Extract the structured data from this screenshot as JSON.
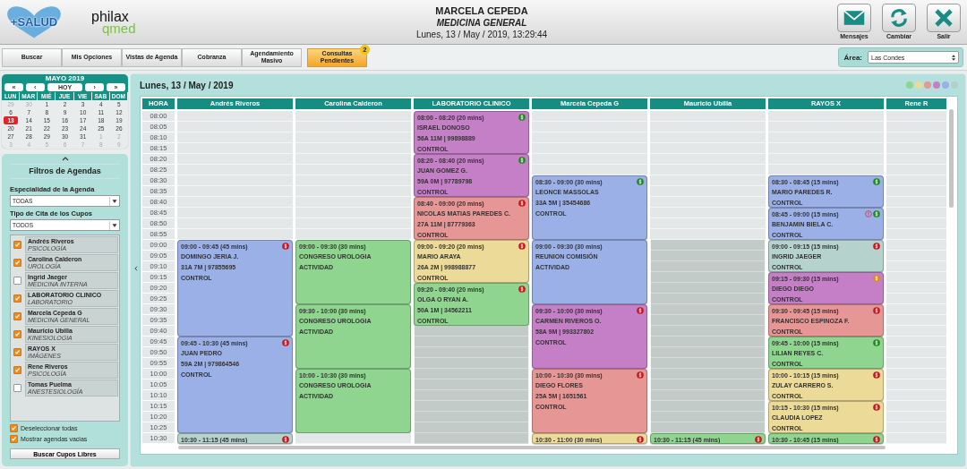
{
  "header": {
    "logo_left": "+SALUD",
    "logo_right_top": "philax",
    "logo_right_bottom": "qmed",
    "user": "MARCELA CEPEDA",
    "specialty": "MEDICINA GENERAL",
    "datetime": "Lunes, 13 / May / 2019, 13:29:44",
    "actions": [
      {
        "label": "Mensajes",
        "kind": "mail"
      },
      {
        "label": "Cambiar",
        "kind": "refresh"
      },
      {
        "label": "Salir",
        "kind": "exit"
      }
    ]
  },
  "nav": {
    "tabs": [
      {
        "label": "Buscar",
        "kind": "plain"
      },
      {
        "label": "Mis Opciones",
        "kind": "plain"
      },
      {
        "label": "Vistas de Agenda",
        "kind": "plain"
      },
      {
        "label": "Cobranza",
        "kind": "plain"
      },
      {
        "label": "Agendamiento Masivo",
        "kind": "plain"
      },
      {
        "label": "Consultas Pendientes",
        "kind": "highlight",
        "badge": "2"
      }
    ],
    "area": {
      "label": "Área:",
      "value": "Las Condes"
    }
  },
  "calendar": {
    "title": "MAYO 2019",
    "nav": [
      "«",
      "‹",
      "HOY",
      "›",
      "»"
    ],
    "weekdays": [
      "LUN",
      "MAR",
      "MIÉ",
      "JUE",
      "VIE",
      "SAB",
      "DOM"
    ],
    "weeks": [
      [
        {
          "day": "29",
          "other_month": true,
          "selected": false
        },
        {
          "day": "30",
          "other_month": true,
          "selected": false
        },
        {
          "day": "1",
          "other_month": false,
          "selected": false
        },
        {
          "day": "2",
          "other_month": false,
          "selected": false
        },
        {
          "day": "3",
          "other_month": false,
          "selected": false
        },
        {
          "day": "4",
          "other_month": false,
          "selected": false
        },
        {
          "day": "5",
          "other_month": false,
          "selected": false
        }
      ],
      [
        {
          "day": "6",
          "other_month": false,
          "selected": false
        },
        {
          "day": "7",
          "other_month": false,
          "selected": false
        },
        {
          "day": "8",
          "other_month": false,
          "selected": false
        },
        {
          "day": "9",
          "other_month": false,
          "selected": false
        },
        {
          "day": "10",
          "other_month": false,
          "selected": false
        },
        {
          "day": "11",
          "other_month": false,
          "selected": false
        },
        {
          "day": "12",
          "other_month": false,
          "selected": false
        }
      ],
      [
        {
          "day": "13",
          "other_month": false,
          "selected": true
        },
        {
          "day": "14",
          "other_month": false,
          "selected": false
        },
        {
          "day": "15",
          "other_month": false,
          "selected": false
        },
        {
          "day": "16",
          "other_month": false,
          "selected": false
        },
        {
          "day": "17",
          "other_month": false,
          "selected": false
        },
        {
          "day": "18",
          "other_month": false,
          "selected": false
        },
        {
          "day": "19",
          "other_month": false,
          "selected": false
        }
      ],
      [
        {
          "day": "20",
          "other_month": false,
          "selected": false
        },
        {
          "day": "21",
          "other_month": false,
          "selected": false
        },
        {
          "day": "22",
          "other_month": false,
          "selected": false
        },
        {
          "day": "23",
          "other_month": false,
          "selected": false
        },
        {
          "day": "24",
          "other_month": false,
          "selected": false
        },
        {
          "day": "25",
          "other_month": false,
          "selected": false
        },
        {
          "day": "26",
          "other_month": false,
          "selected": false
        }
      ],
      [
        {
          "day": "27",
          "other_month": false,
          "selected": false
        },
        {
          "day": "28",
          "other_month": false,
          "selected": false
        },
        {
          "day": "29",
          "other_month": false,
          "selected": false
        },
        {
          "day": "30",
          "other_month": false,
          "selected": false
        },
        {
          "day": "31",
          "other_month": false,
          "selected": false
        },
        {
          "day": "1",
          "other_month": true,
          "selected": false
        },
        {
          "day": "2",
          "other_month": true,
          "selected": false
        }
      ],
      [
        {
          "day": "3",
          "other_month": true,
          "selected": false
        },
        {
          "day": "4",
          "other_month": true,
          "selected": false
        },
        {
          "day": "5",
          "other_month": true,
          "selected": false
        },
        {
          "day": "6",
          "other_month": true,
          "selected": false
        },
        {
          "day": "7",
          "other_month": true,
          "selected": false
        },
        {
          "day": "8",
          "other_month": true,
          "selected": false
        },
        {
          "day": "9",
          "other_month": true,
          "selected": false
        }
      ]
    ]
  },
  "filters": {
    "title": "Filtros de Agendas",
    "fields": [
      {
        "label": "Especialidad de la Agenda",
        "value": "TODAS"
      },
      {
        "label": "Tipo de Cita de los Cupos",
        "value": "TODOS"
      }
    ],
    "agendas": [
      {
        "name": "Andrés Riveros",
        "specialty": "PSICOLOGÍA",
        "checked": true
      },
      {
        "name": "Carolina Calderon",
        "specialty": "UROLOGÍA",
        "checked": true
      },
      {
        "name": "Ingrid Jaeger",
        "specialty": "MEDICINA INTERNA",
        "checked": false
      },
      {
        "name": "LABORATORIO CLINICO",
        "specialty": "LABORATORIO",
        "checked": true
      },
      {
        "name": "Marcela Cepeda G",
        "specialty": "MEDICINA GENERAL",
        "checked": true
      },
      {
        "name": "Mauricio Ubilla",
        "specialty": "KINESIOLOGIA",
        "checked": true
      },
      {
        "name": "RAYOS X",
        "specialty": "IMÁGENES",
        "checked": true
      },
      {
        "name": "Rene Riveros",
        "specialty": "PSICOLOGÍA",
        "checked": true
      },
      {
        "name": "Tomas Puelma",
        "specialty": "ANESTESIOLOGÍA",
        "checked": false
      }
    ],
    "options": [
      {
        "label": "Deseleccionar todas",
        "checked": true
      },
      {
        "label": "Mostrar agendas vacias",
        "checked": true
      }
    ],
    "button": "Buscar Cupos Libres"
  },
  "schedule": {
    "date": "Lunes, 13 / May / 2019",
    "legend": [
      {
        "color": "#8fd48f"
      },
      {
        "color": "#ecdb98"
      },
      {
        "color": "#e69694"
      },
      {
        "color": "#c47fc6"
      },
      {
        "color": "#9bb0e6"
      },
      {
        "color": "#b5cfca"
      }
    ],
    "hour_header": "HORA",
    "hours": [
      "08:00",
      "08:05",
      "08:10",
      "08:15",
      "08:20",
      "08:25",
      "08:30",
      "08:35",
      "08:40",
      "08:45",
      "08:50",
      "08:55",
      "09:00",
      "09:05",
      "09:10",
      "09:15",
      "09:20",
      "09:25",
      "09:30",
      "09:35",
      "09:40",
      "09:45",
      "09:50",
      "09:55",
      "10:00",
      "10:05",
      "10:10",
      "10:15",
      "10:20",
      "10:25",
      "10:30"
    ],
    "columns": [
      {
        "name": "Andrés Riveros",
        "entries": [
          {
            "kind": "free"
          },
          {
            "kind": "free"
          },
          {
            "kind": "free"
          },
          {
            "kind": "free"
          },
          {
            "kind": "free"
          },
          {
            "kind": "free"
          },
          {
            "kind": "free"
          },
          {
            "kind": "free"
          },
          {
            "kind": "free"
          },
          {
            "kind": "free"
          },
          {
            "kind": "free"
          },
          {
            "kind": "free"
          },
          {
            "kind": "appointment",
            "color": "#9bb0e6",
            "time": "09:00 - 09:45 (45 mins)",
            "lines": [
              "DOMINGO JERIA J.",
              "31A 7M | 97855695",
              "CONTROL"
            ],
            "payment_icon": {
              "color": "#c8151b"
            },
            "alert": false
          },
          {
            "kind": "appointment",
            "color": "#9bb0e6",
            "time": "09:45 - 10:30 (45 mins)",
            "lines": [
              "JUAN PEDRO",
              "59A 2M | 979864546",
              "CONTROL"
            ],
            "payment_icon": {
              "color": "#c8151b"
            },
            "alert": false
          },
          {
            "kind": "appointment",
            "color": "#b5d3cc",
            "time": "10:30 - 11:15 (45 mins)",
            "payment_icon": {
              "color": "#c8151b"
            },
            "alert": false
          }
        ]
      },
      {
        "name": "Carolina Calderon",
        "entries": [
          {
            "kind": "free"
          },
          {
            "kind": "free"
          },
          {
            "kind": "free"
          },
          {
            "kind": "free"
          },
          {
            "kind": "free"
          },
          {
            "kind": "free"
          },
          {
            "kind": "free"
          },
          {
            "kind": "free"
          },
          {
            "kind": "free"
          },
          {
            "kind": "free"
          },
          {
            "kind": "free"
          },
          {
            "kind": "free"
          },
          {
            "kind": "appointment",
            "color": "#8fd48f",
            "time": "09:00 - 09:30 (30 mins)",
            "lines": [
              "CONGRESO UROLOGIA",
              "ACTIVIDAD"
            ],
            "alert": false
          },
          {
            "kind": "appointment",
            "color": "#8fd48f",
            "time": "09:30 - 10:00 (30 mins)",
            "lines": [
              "CONGRESO UROLOGIA",
              "ACTIVIDAD"
            ],
            "alert": false
          },
          {
            "kind": "appointment",
            "color": "#8fd48f",
            "time": "10:00 - 10:30 (30 mins)",
            "lines": [
              "CONGRESO UROLOGIA",
              "ACTIVIDAD"
            ],
            "alert": false
          },
          {
            "kind": "free"
          }
        ]
      },
      {
        "name": "LABORATORIO CLINICO",
        "entries": [
          {
            "kind": "appointment",
            "color": "#c47fc6",
            "time": "08:00 - 08:20 (20 mins)",
            "lines": [
              "ISRAEL DONOSO",
              "56A 11M | 99898889",
              "CONTROL"
            ],
            "payment_icon": {
              "color": "#1f8a1f"
            },
            "alert": false
          },
          {
            "kind": "appointment",
            "color": "#c47fc6",
            "time": "08:20 - 08:40 (20 mins)",
            "lines": [
              "JUAN GOMEZ G.",
              "59A 0M | 97789798",
              "CONTROL"
            ],
            "payment_icon": {
              "color": "#1f8a1f"
            },
            "alert": false
          },
          {
            "kind": "appointment",
            "color": "#e69694",
            "time": "08:40 - 09:00 (20 mins)",
            "lines": [
              "NICOLAS MATIAS PAREDES C.",
              "27A 11M | 87779363",
              "CONTROL"
            ],
            "payment_icon": {
              "color": "#c8151b"
            },
            "alert": false
          },
          {
            "kind": "appointment",
            "color": "#ecdb98",
            "time": "09:00 - 09:20 (20 mins)",
            "lines": [
              "MARIO ARAYA",
              "26A 2M | 998988877",
              "CONTROL"
            ],
            "payment_icon": {
              "color": "#c8151b"
            },
            "alert": false
          },
          {
            "kind": "appointment",
            "color": "#8fd48f",
            "time": "09:20 - 09:40 (20 mins)",
            "lines": [
              "OLGA O RYAN A.",
              "50A 1M | 34562211",
              "CONTROL"
            ],
            "payment_icon": {
              "color": "#c8151b"
            },
            "alert": false
          },
          {
            "kind": "blocked"
          },
          {
            "kind": "blocked"
          },
          {
            "kind": "blocked"
          },
          {
            "kind": "blocked"
          },
          {
            "kind": "blocked"
          },
          {
            "kind": "blocked"
          },
          {
            "kind": "blocked"
          },
          {
            "kind": "blocked"
          },
          {
            "kind": "blocked"
          },
          {
            "kind": "blocked"
          },
          {
            "kind": "blocked"
          }
        ]
      },
      {
        "name": "Marcela Cepeda G",
        "entries": [
          {
            "kind": "free"
          },
          {
            "kind": "free"
          },
          {
            "kind": "free"
          },
          {
            "kind": "free"
          },
          {
            "kind": "free"
          },
          {
            "kind": "free"
          },
          {
            "kind": "appointment",
            "color": "#9bb0e6",
            "time": "08:30 - 09:00 (30 mins)",
            "lines": [
              "LEONCE MASSOLAS",
              "33A 5M | 35454686",
              "CONTROL"
            ],
            "payment_icon": {
              "color": "#1f8a1f"
            },
            "alert": false
          },
          {
            "kind": "appointment",
            "color": "#9bb0e6",
            "time": "09:00 - 09:30 (30 mins)",
            "lines": [
              "REUNION COMISIÓN",
              "ACTIVIDAD"
            ],
            "alert": false
          },
          {
            "kind": "appointment",
            "color": "#c47fc6",
            "time": "09:30 - 10:00 (30 mins)",
            "lines": [
              "CARMEN RIVEROS O.",
              "58A 9M | 993327802",
              "CONTROL"
            ],
            "payment_icon": {
              "color": "#c8151b"
            },
            "alert": false
          },
          {
            "kind": "appointment",
            "color": "#e69694",
            "time": "10:00 - 10:30 (30 mins)",
            "lines": [
              "DIEGO FLORES",
              "25A 5M | 1651561",
              "CONTROL"
            ],
            "payment_icon": {
              "color": "#c8151b"
            },
            "alert": false
          },
          {
            "kind": "appointment",
            "color": "#ecdb98",
            "time": "10:30 - 11:00 (30 mins)",
            "payment_icon": {
              "color": "#c8151b"
            },
            "alert": false
          }
        ]
      },
      {
        "name": "Mauricio Ubilla",
        "entries": [
          {
            "kind": "free"
          },
          {
            "kind": "free"
          },
          {
            "kind": "free"
          },
          {
            "kind": "free"
          },
          {
            "kind": "free"
          },
          {
            "kind": "free"
          },
          {
            "kind": "free"
          },
          {
            "kind": "free"
          },
          {
            "kind": "free"
          },
          {
            "kind": "free"
          },
          {
            "kind": "free"
          },
          {
            "kind": "free"
          },
          {
            "kind": "blocked"
          },
          {
            "kind": "blocked"
          },
          {
            "kind": "blocked"
          },
          {
            "kind": "blocked"
          },
          {
            "kind": "blocked"
          },
          {
            "kind": "blocked"
          },
          {
            "kind": "blocked"
          },
          {
            "kind": "blocked"
          },
          {
            "kind": "blocked"
          },
          {
            "kind": "blocked"
          },
          {
            "kind": "blocked"
          },
          {
            "kind": "blocked"
          },
          {
            "kind": "blocked"
          },
          {
            "kind": "blocked"
          },
          {
            "kind": "blocked"
          },
          {
            "kind": "blocked"
          },
          {
            "kind": "blocked"
          },
          {
            "kind": "blocked"
          },
          {
            "kind": "appointment",
            "color": "#8fd48f",
            "time": "10:30 - 11:15 (45 mins)",
            "payment_icon": {
              "color": "#c8151b"
            },
            "alert": false
          }
        ]
      },
      {
        "name": "RAYOS X",
        "entries": [
          {
            "kind": "free"
          },
          {
            "kind": "free"
          },
          {
            "kind": "free"
          },
          {
            "kind": "free"
          },
          {
            "kind": "free"
          },
          {
            "kind": "free"
          },
          {
            "kind": "appointment",
            "color": "#9bb0e6",
            "time": "08:30 - 08:45 (15 mins)",
            "lines": [
              "MARIO PAREDES R.",
              "CONTROL"
            ],
            "payment_icon": {
              "color": "#1f8a1f"
            },
            "alert": false
          },
          {
            "kind": "appointment",
            "color": "#9bb0e6",
            "time": "08:45 - 09:00 (15 mins)",
            "lines": [
              "BENJAMIN BIELA C.",
              "CONTROL"
            ],
            "payment_icon": {
              "color": "#1f8a1f"
            },
            "alert": true
          },
          {
            "kind": "appointment",
            "color": "#b5d3cc",
            "time": "09:00 - 09:15 (15 mins)",
            "lines": [
              "INGRID JAEGER",
              "CONTROL"
            ],
            "payment_icon": {
              "color": "#c8151b"
            },
            "alert": false
          },
          {
            "kind": "appointment",
            "color": "#c47fc6",
            "time": "09:15 - 09:30 (15 mins)",
            "lines": [
              "DIEGO DIEGO",
              "CONTROL"
            ],
            "payment_icon": {
              "color": "#e08a12"
            },
            "alert": false
          },
          {
            "kind": "appointment",
            "color": "#e69694",
            "time": "09:30 - 09:45 (15 mins)",
            "lines": [
              "FRANCISCO ESPINOZA F.",
              "CONTROL"
            ],
            "payment_icon": {
              "color": "#c8151b"
            },
            "alert": false
          },
          {
            "kind": "appointment",
            "color": "#8fd48f",
            "time": "09:45 - 10:00 (15 mins)",
            "lines": [
              "LILIAN REYES C.",
              "CONTROL"
            ],
            "payment_icon": {
              "color": "#1f8a1f"
            },
            "alert": false
          },
          {
            "kind": "appointment",
            "color": "#ecdb98",
            "time": "10:00 - 10:15 (15 mins)",
            "lines": [
              "ZULAY CARRERO S.",
              "CONTROL"
            ],
            "payment_icon": {
              "color": "#c8151b"
            },
            "alert": false
          },
          {
            "kind": "appointment",
            "color": "#ecdb98",
            "time": "10:15 - 10:30 (15 mins)",
            "lines": [
              "CLAUDIA LOPEZ",
              "CONTROL"
            ],
            "payment_icon": {
              "color": "#c8151b"
            },
            "alert": false
          },
          {
            "kind": "appointment",
            "color": "#8fd48f",
            "time": "10:30 - 10:45 (15 mins)",
            "payment_icon": {
              "color": "#c8151b"
            },
            "alert": false
          }
        ]
      },
      {
        "name": "Rene R",
        "entries": [
          {
            "kind": "free"
          },
          {
            "kind": "free"
          },
          {
            "kind": "free"
          },
          {
            "kind": "free"
          },
          {
            "kind": "free"
          },
          {
            "kind": "free"
          },
          {
            "kind": "free"
          },
          {
            "kind": "free"
          },
          {
            "kind": "free"
          },
          {
            "kind": "free"
          },
          {
            "kind": "free"
          },
          {
            "kind": "free"
          },
          {
            "kind": "free"
          },
          {
            "kind": "free"
          },
          {
            "kind": "free"
          },
          {
            "kind": "free"
          },
          {
            "kind": "free"
          },
          {
            "kind": "free"
          },
          {
            "kind": "free"
          },
          {
            "kind": "free"
          },
          {
            "kind": "free"
          },
          {
            "kind": "free"
          },
          {
            "kind": "free"
          },
          {
            "kind": "free"
          },
          {
            "kind": "free"
          },
          {
            "kind": "free"
          },
          {
            "kind": "free"
          },
          {
            "kind": "free"
          },
          {
            "kind": "free"
          },
          {
            "kind": "free"
          },
          {
            "kind": "free"
          }
        ]
      }
    ]
  }
}
